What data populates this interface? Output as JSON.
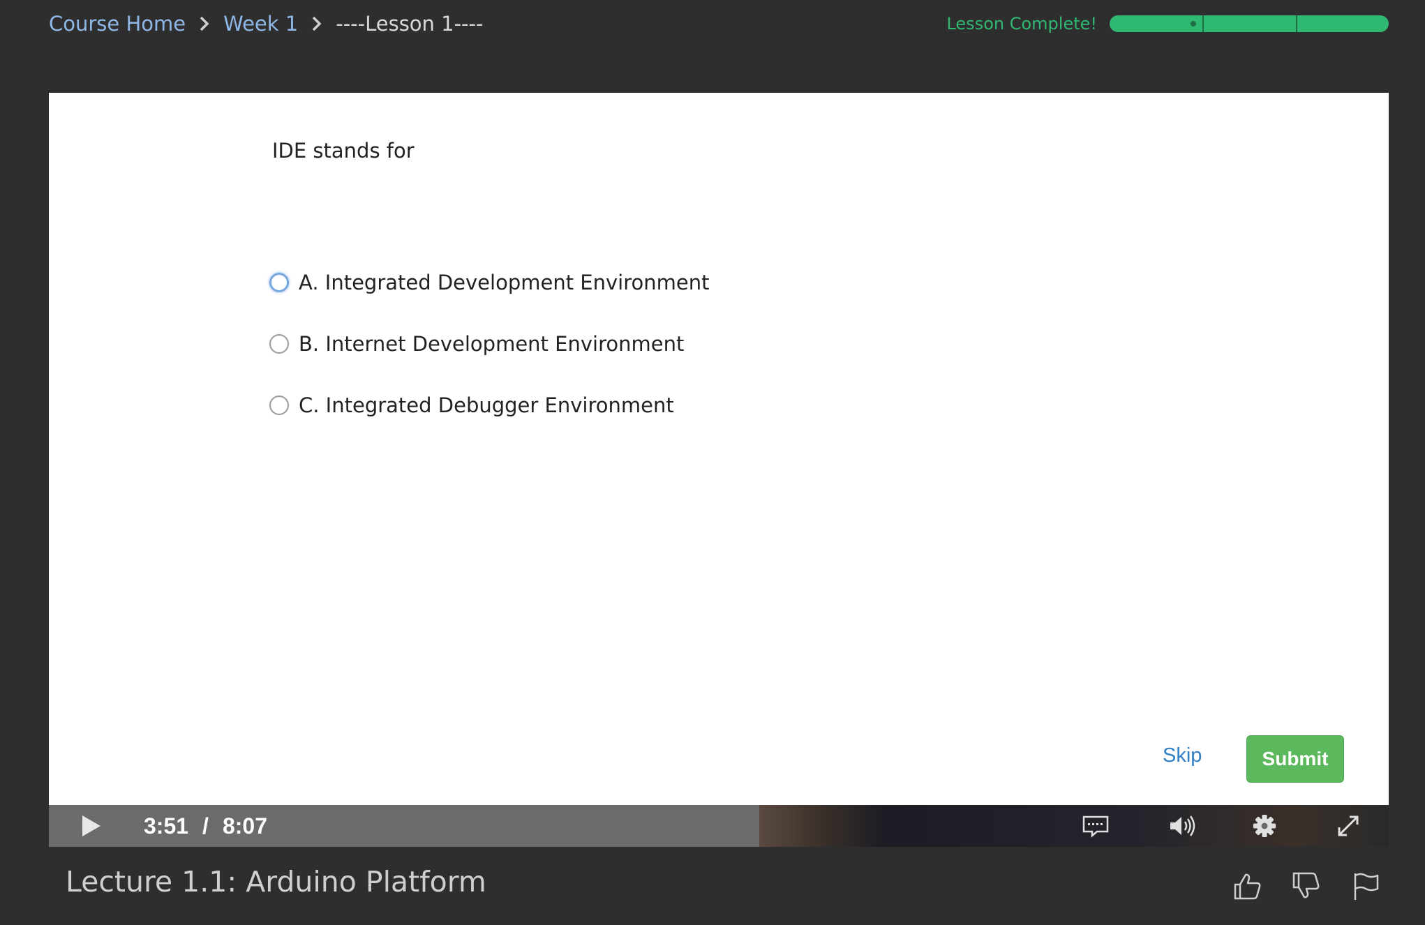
{
  "breadcrumb": {
    "items": [
      {
        "label": "Course Home"
      },
      {
        "label": "Week 1"
      },
      {
        "label": "----Lesson 1----"
      }
    ]
  },
  "progress": {
    "label": "Lesson Complete!",
    "percent": 100,
    "segments": 3,
    "marker_percent": 30,
    "color": "#2fb872"
  },
  "quiz": {
    "question": "IDE stands for",
    "options": [
      {
        "label": "A. Integrated Development Environment"
      },
      {
        "label": "B. Internet Development Environment"
      },
      {
        "label": "C. Integrated Debugger Environment"
      }
    ],
    "skip_label": "Skip",
    "submit_label": "Submit",
    "submit_color": "#5cb85c",
    "skip_color": "#2f7fc7"
  },
  "player": {
    "current_time": "3:51",
    "separator": "/",
    "duration": "8:07",
    "icons": [
      "play-icon",
      "captions-icon",
      "volume-icon",
      "settings-icon",
      "fullscreen-icon"
    ]
  },
  "lecture": {
    "title": "Lecture 1.1: Arduino Platform",
    "icons": [
      "thumbs-up-icon",
      "thumbs-down-icon",
      "flag-icon"
    ]
  }
}
